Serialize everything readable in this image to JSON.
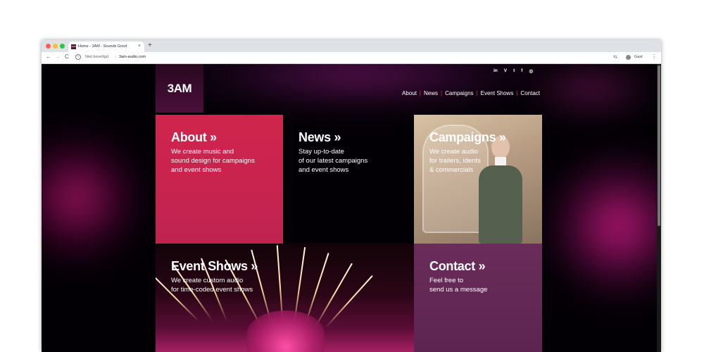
{
  "browser": {
    "tab_title": "Home - 3AM - Sounds Good",
    "favicon_text": "3AM",
    "new_tab_label": "+",
    "close_tab_label": "×",
    "security_label": "Niet beveiligd",
    "url": "3am-audio.com",
    "profile_label": "Gast",
    "back_icon": "←",
    "forward_icon": "→",
    "reload_icon": "C",
    "info_icon": "i",
    "translate_icon": "⇆",
    "menu_icon": "⋮"
  },
  "site": {
    "logo": "3AM",
    "social": [
      "in",
      "V",
      "t",
      "f",
      "◎"
    ],
    "nav": [
      "About",
      "News",
      "Campaigns",
      "Event Shows",
      "Contact"
    ],
    "tiles": {
      "about": {
        "title": "About »",
        "desc_lines": [
          "We create music and",
          "sound design for campaigns",
          "and event shows"
        ]
      },
      "news": {
        "title": "News »",
        "desc_lines": [
          "Stay up-to-date",
          "of our latest campaigns",
          "and event shows"
        ]
      },
      "campaigns": {
        "title": "Campaigns »",
        "desc_lines": [
          "We create audio",
          "for trailers, idents",
          "& commercials"
        ]
      },
      "event_shows": {
        "title": "Event Shows »",
        "desc_lines": [
          "We create custom audio",
          "for time-coded event shows"
        ]
      },
      "contact": {
        "title": "Contact »",
        "desc_lines": [
          "Feel free to",
          "send us a message"
        ]
      }
    }
  },
  "colors": {
    "about_tile": "#d0254d",
    "contact_tile": "#6b2c5a",
    "nav_separator": "#e0305c",
    "page_background": "#030005"
  }
}
